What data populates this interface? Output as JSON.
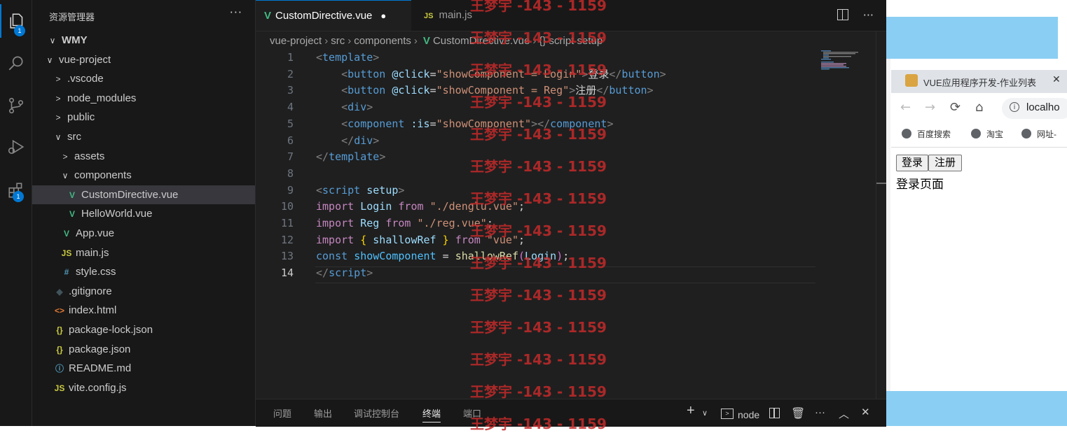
{
  "activity_bar": {
    "explorer_badge": "1",
    "extensions_badge": "1"
  },
  "sidebar": {
    "header": "资源管理器",
    "more": "···",
    "tree": [
      {
        "label": "WMY",
        "chevron": "∨",
        "indent": 0,
        "bold": true
      },
      {
        "label": "vue-project",
        "chevron": "∨",
        "indent": 1
      },
      {
        "label": ".vscode",
        "chevron": ">",
        "indent": 2
      },
      {
        "label": "node_modules",
        "chevron": ">",
        "indent": 2
      },
      {
        "label": "public",
        "chevron": ">",
        "indent": 2
      },
      {
        "label": "src",
        "chevron": "∨",
        "indent": 2
      },
      {
        "label": "assets",
        "chevron": ">",
        "indent": 3
      },
      {
        "label": "components",
        "chevron": "∨",
        "indent": 3
      },
      {
        "label": "CustomDirective.vue",
        "icon": "V",
        "icon_color": "#42b883",
        "indent": 4,
        "selected": true
      },
      {
        "label": "HelloWorld.vue",
        "icon": "V",
        "icon_color": "#42b883",
        "indent": 4
      },
      {
        "label": "App.vue",
        "icon": "V",
        "icon_color": "#42b883",
        "indent": 3
      },
      {
        "label": "main.js",
        "icon": "JS",
        "icon_color": "#cbcb41",
        "indent": 3
      },
      {
        "label": "style.css",
        "icon": "#",
        "icon_color": "#519aba",
        "indent": 3
      },
      {
        "label": ".gitignore",
        "icon": "◆",
        "icon_color": "#41535b",
        "indent": 2
      },
      {
        "label": "index.html",
        "icon": "<>",
        "icon_color": "#e37933",
        "indent": 2
      },
      {
        "label": "package-lock.json",
        "icon": "{}",
        "icon_color": "#cbcb41",
        "indent": 2
      },
      {
        "label": "package.json",
        "icon": "{}",
        "icon_color": "#cbcb41",
        "indent": 2
      },
      {
        "label": "README.md",
        "icon": "ⓘ",
        "icon_color": "#519aba",
        "indent": 2
      },
      {
        "label": "vite.config.js",
        "icon": "JS",
        "icon_color": "#cbcb41",
        "indent": 2
      }
    ]
  },
  "editor": {
    "tabs": [
      {
        "label": "CustomDirective.vue",
        "icon": "V",
        "active": true,
        "modified_dot": "●"
      },
      {
        "label": "main.js",
        "icon": "JS",
        "active": false
      }
    ],
    "breadcrumb": [
      "vue-project",
      "src",
      "components",
      "CustomDirective.vue",
      "{} script setup"
    ],
    "current_line": 14,
    "lines": [
      [
        [
          "<",
          "t-br"
        ],
        [
          "template",
          "t-tag"
        ],
        [
          ">",
          "t-br"
        ]
      ],
      [
        [
          "    <",
          "t-br"
        ],
        [
          "button",
          "t-tag"
        ],
        [
          " @click",
          "t-attr"
        ],
        [
          "=",
          "t-txt"
        ],
        [
          "\"showComponent = Login\"",
          "t-str"
        ],
        [
          ">",
          "t-br"
        ],
        [
          "登录",
          "t-txt"
        ],
        [
          "</",
          "t-br"
        ],
        [
          "button",
          "t-tag"
        ],
        [
          ">",
          "t-br"
        ]
      ],
      [
        [
          "    <",
          "t-br"
        ],
        [
          "button",
          "t-tag"
        ],
        [
          " @click",
          "t-attr"
        ],
        [
          "=",
          "t-txt"
        ],
        [
          "\"showComponent = Reg\"",
          "t-str"
        ],
        [
          ">",
          "t-br"
        ],
        [
          "注册",
          "t-txt"
        ],
        [
          "</",
          "t-br"
        ],
        [
          "button",
          "t-tag"
        ],
        [
          ">",
          "t-br"
        ]
      ],
      [
        [
          "    <",
          "t-br"
        ],
        [
          "div",
          "t-tag"
        ],
        [
          ">",
          "t-br"
        ]
      ],
      [
        [
          "    <",
          "t-br"
        ],
        [
          "component",
          "t-tag"
        ],
        [
          " :is",
          "t-attr"
        ],
        [
          "=",
          "t-txt"
        ],
        [
          "\"showComponent\"",
          "t-str"
        ],
        [
          "></",
          "t-br"
        ],
        [
          "component",
          "t-tag"
        ],
        [
          ">",
          "t-br"
        ]
      ],
      [
        [
          "    </",
          "t-br"
        ],
        [
          "div",
          "t-tag"
        ],
        [
          ">",
          "t-br"
        ]
      ],
      [
        [
          "</",
          "t-br"
        ],
        [
          "template",
          "t-tag"
        ],
        [
          ">",
          "t-br"
        ]
      ],
      [],
      [
        [
          "<",
          "t-br"
        ],
        [
          "script",
          "t-tag"
        ],
        [
          " setup",
          "t-attr"
        ],
        [
          ">",
          "t-br"
        ]
      ],
      [
        [
          "import",
          "t-kw"
        ],
        [
          " ",
          "t-txt"
        ],
        [
          "Login",
          "t-var"
        ],
        [
          " ",
          "t-txt"
        ],
        [
          "from",
          "t-kw"
        ],
        [
          " ",
          "t-txt"
        ],
        [
          "\"./denglu.vue\"",
          "t-str"
        ],
        [
          ";",
          "t-txt"
        ]
      ],
      [
        [
          "import",
          "t-kw"
        ],
        [
          " ",
          "t-txt"
        ],
        [
          "Reg",
          "t-var"
        ],
        [
          " ",
          "t-txt"
        ],
        [
          "from",
          "t-kw"
        ],
        [
          " ",
          "t-txt"
        ],
        [
          "\"./reg.vue\"",
          "t-str"
        ],
        [
          ";",
          "t-txt"
        ]
      ],
      [
        [
          "import",
          "t-kw"
        ],
        [
          " ",
          "t-txt"
        ],
        [
          "{",
          "t-brk"
        ],
        [
          " shallowRef ",
          "t-var"
        ],
        [
          "}",
          "t-brk"
        ],
        [
          " ",
          "t-txt"
        ],
        [
          "from",
          "t-kw"
        ],
        [
          " ",
          "t-txt"
        ],
        [
          "\"vue\"",
          "t-str"
        ],
        [
          ";",
          "t-txt"
        ]
      ],
      [
        [
          "const",
          "t-kw2"
        ],
        [
          " ",
          "t-txt"
        ],
        [
          "showComponent",
          "t-const"
        ],
        [
          " = ",
          "t-txt"
        ],
        [
          "shallowRef",
          "t-fn"
        ],
        [
          "(",
          "t-brk2"
        ],
        [
          "Login",
          "t-var"
        ],
        [
          ")",
          "t-brk2"
        ],
        [
          ";",
          "t-txt"
        ]
      ],
      [
        [
          "</",
          "t-br"
        ],
        [
          "script",
          "t-tag"
        ],
        [
          ">",
          "t-br"
        ]
      ]
    ]
  },
  "panel": {
    "tabs": [
      "问题",
      "输出",
      "调试控制台",
      "终端",
      "端口"
    ],
    "active_tab": "终端",
    "terminal_name": "node"
  },
  "watermark": {
    "text": "王梦宇 -143 - 1159",
    "color": "#c42a2a"
  },
  "browser": {
    "tab_title": "VUE应用程序开发-作业列表",
    "tab_close": "✕",
    "address": "localho",
    "bookmarks": [
      "百度搜索",
      "淘宝",
      "网址-"
    ],
    "page": {
      "buttons": [
        "登录",
        "注册"
      ],
      "content": "登录页面"
    }
  }
}
